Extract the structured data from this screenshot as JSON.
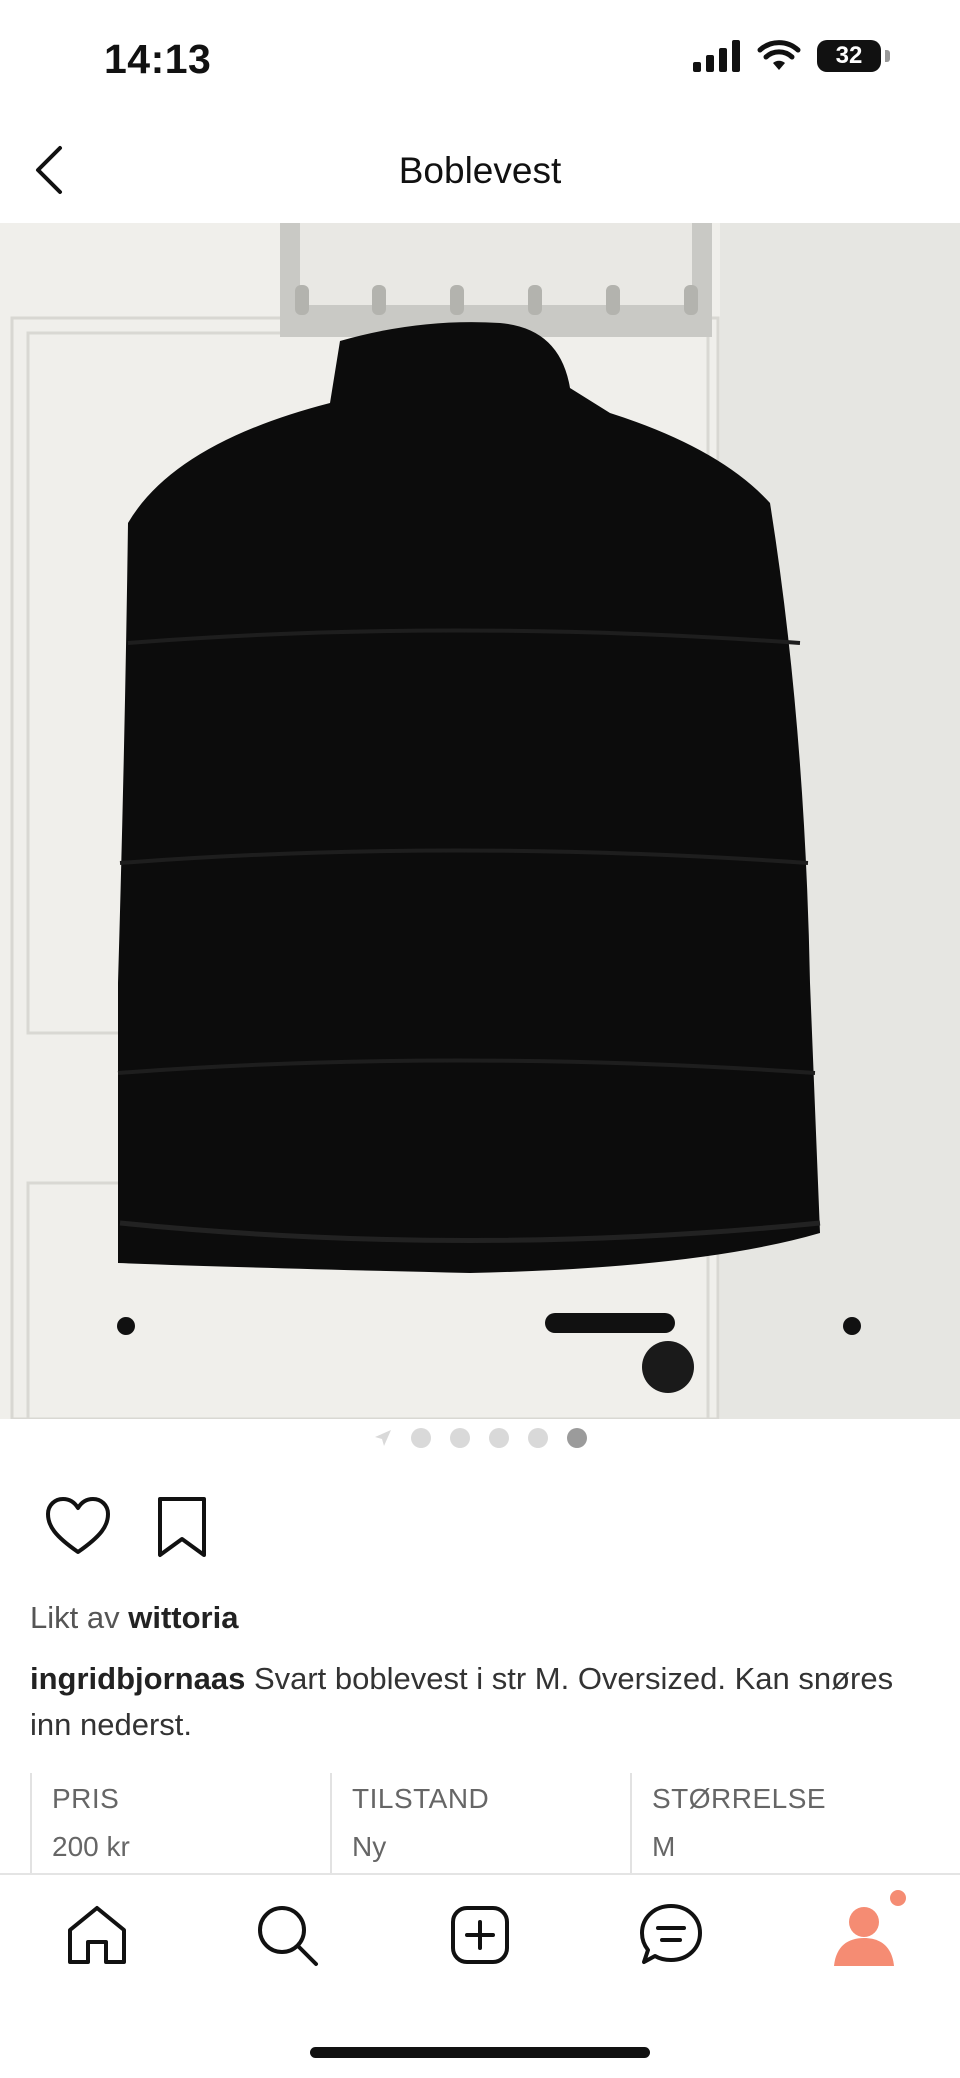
{
  "status_bar": {
    "time": "14:13",
    "battery": "32"
  },
  "header": {
    "title": "Boblevest"
  },
  "gallery": {
    "total_dots": 5,
    "active_index": 4
  },
  "post": {
    "liked_prefix": "Likt av",
    "liked_user": "wittoria",
    "author": "ingridbjornaas",
    "caption": "Svart boblevest i str M. Oversized. Kan snøres inn nederst."
  },
  "info": [
    {
      "label": "PRIS",
      "value": "200 kr"
    },
    {
      "label": "TILSTAND",
      "value": "Ny"
    },
    {
      "label": "STØRRELSE",
      "value": "M"
    }
  ],
  "tabs": [
    "home-icon",
    "search-icon",
    "add-icon",
    "messages-icon",
    "profile-icon"
  ],
  "colors": {
    "accent": "#f58c73",
    "text": "#2b2b2b"
  }
}
